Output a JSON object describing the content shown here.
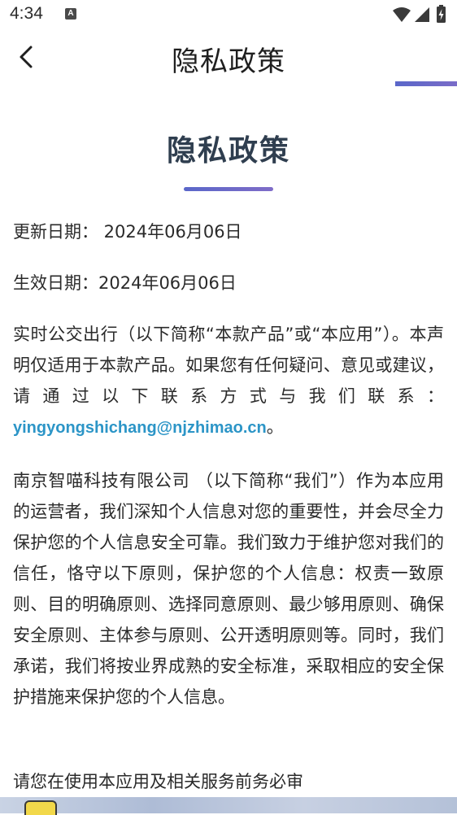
{
  "status_bar": {
    "time": "4:34",
    "indicator_letter": "A"
  },
  "app_bar": {
    "title": "隐私政策"
  },
  "document": {
    "title": "隐私政策",
    "update_date": "更新日期： 2024年06月06日",
    "effective_date": "生效日期：2024年06月06日",
    "intro_text": "实时公交出行（以下简称“本款产品”或“本应用”）。本声明仅适用于本款产品。如果您有任何疑问、意见或建议，请通过以下联系方式与我们联系：",
    "contact_email": "yingyongshichang@njzhimao.cn",
    "intro_end": "。",
    "company_paragraph": "南京智喵科技有限公司 （以下简称“我们”）作为本应用的运营者，我们深知个人信息对您的重要性，并会尽全力保护您的个人信息安全可靠。我们致力于维护您对我们的信任，恪守以下原则，保护您的个人信息：权责一致原则、目的明确原则、选择同意原则、最少够用原则、确保安全原则、主体参与原则、公开透明原则等。同时，我们承诺，我们将按业界成熟的安全标准，采取相应的安全保护措施来保护您的个人信息。",
    "partial_paragraph": "请您在使用本应用及相关服务前务必审"
  },
  "colors": {
    "accent_start": "#5a67c9",
    "accent_end": "#7f6cc8",
    "link": "#2c95c7",
    "title": "#2f3e4f"
  }
}
